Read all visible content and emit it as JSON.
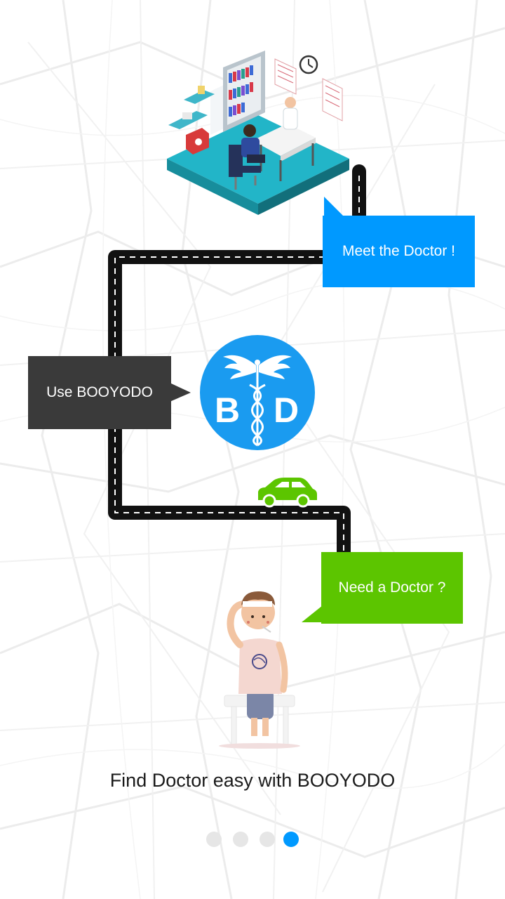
{
  "onboarding": {
    "bubbles": {
      "meet": "Meet the Doctor !",
      "use": "Use BOOYODO",
      "need": "Need a Doctor ?"
    },
    "logo_letters": {
      "left": "B",
      "right": "D"
    },
    "tagline": "Find Doctor easy with BOOYODO",
    "pager": {
      "total": 4,
      "active_index": 3
    }
  },
  "colors": {
    "blue": "#0099ff",
    "dark": "#3a3a3a",
    "green": "#5cc500",
    "road": "#111111",
    "car": "#5cc500",
    "floor": "#22b5c8"
  },
  "icons": [
    "map-background",
    "clinic-illustration",
    "caduceus-logo-icon",
    "car-icon",
    "sick-patient-illustration"
  ]
}
